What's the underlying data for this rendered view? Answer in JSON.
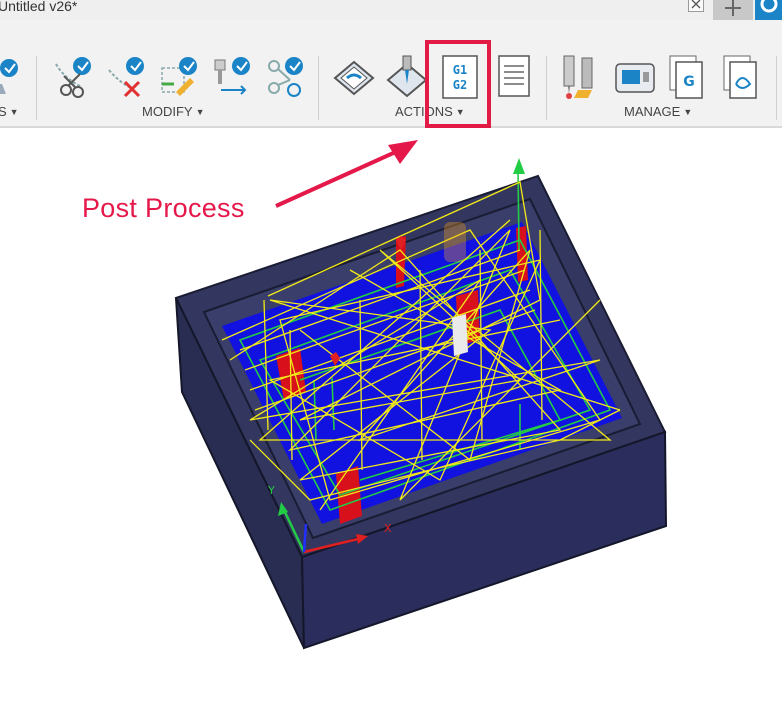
{
  "window": {
    "title": "Untitled v26*"
  },
  "toolbar": {
    "groups": [
      {
        "label": "S",
        "has_dropdown": true
      },
      {
        "label": "MODIFY",
        "has_dropdown": true
      },
      {
        "label": "ACTIONS",
        "has_dropdown": true
      },
      {
        "label": "MANAGE",
        "has_dropdown": true
      }
    ],
    "tools": {
      "partial": "partial-icon",
      "modify_1": "scissors-icon",
      "modify_2": "delete-toolpath-icon",
      "modify_3": "edit-toolpath-icon",
      "modify_4": "tool-move-icon",
      "modify_5": "branch-icon",
      "actions_1": "simulate-icon",
      "actions_2": "simulate-stock-icon",
      "actions_post": "post-process-icon",
      "actions_post_label": "G1\nG2",
      "actions_4": "setup-sheet-icon",
      "manage_1": "tool-library-icon",
      "manage_2": "machine-library-icon",
      "manage_3": "nc-program-icon",
      "manage_4": "template-icon"
    }
  },
  "annotation": {
    "text": "Post Process",
    "color": "#e5184a"
  },
  "viewport": {
    "axis_x": "X",
    "axis_y": "Y"
  },
  "colors": {
    "highlight": "#e21a46",
    "stock": "#2b2e5c",
    "floor": "#1212e0",
    "toolpath": "#f2ea18",
    "accent": "#1a84c7"
  }
}
